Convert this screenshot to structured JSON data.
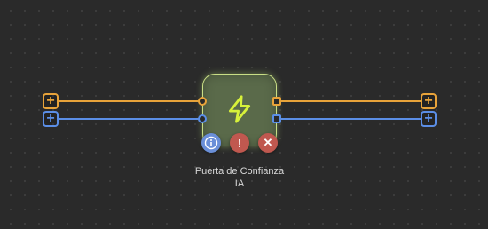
{
  "node": {
    "title_line1": "Puerta de Confianza",
    "title_line2": "IA",
    "icon": "lightning-bolt-icon",
    "icon_color": "#d7f13a",
    "background": "#5a6a4a"
  },
  "ports": {
    "add_symbol": "+",
    "orange": "#e8a33a",
    "blue": "#5b8ee6"
  },
  "actions": {
    "info": {
      "icon": "info-icon",
      "symbol": "i",
      "color": "#6a8fd8"
    },
    "warning": {
      "icon": "exclamation-icon",
      "symbol": "!",
      "color": "#c0584f"
    },
    "delete": {
      "icon": "close-icon",
      "symbol": "✕",
      "color": "#c0584f"
    }
  }
}
